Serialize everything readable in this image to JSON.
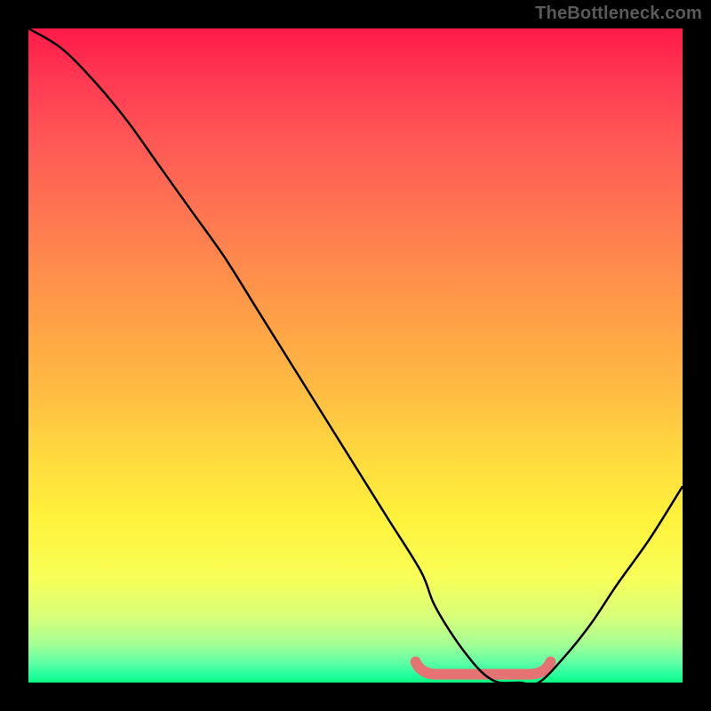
{
  "watermark": "TheBottleneck.com",
  "chart_data": {
    "type": "line",
    "title": "",
    "xlabel": "",
    "ylabel": "",
    "xlim": [
      0,
      100
    ],
    "ylim": [
      0,
      100
    ],
    "grid": false,
    "legend": false,
    "series": [
      {
        "name": "bottleneck-curve",
        "x": [
          0,
          5,
          10,
          15,
          20,
          25,
          30,
          35,
          40,
          45,
          50,
          55,
          60,
          62,
          65,
          68,
          70,
          72,
          75,
          78,
          82,
          86,
          90,
          95,
          100
        ],
        "y": [
          100,
          97,
          92,
          86,
          79,
          72,
          65,
          57,
          49,
          41,
          33,
          25,
          17,
          12,
          7,
          3,
          1,
          0,
          0,
          0,
          4,
          9,
          15,
          22,
          30
        ]
      }
    ],
    "highlight_range": {
      "name": "optimal-zone",
      "x_start": 60,
      "x_end": 79,
      "y": 1
    },
    "background_gradient": {
      "top": "#ff1a4a",
      "mid": "#ffdb3e",
      "bottom": "#0cf77f"
    }
  }
}
